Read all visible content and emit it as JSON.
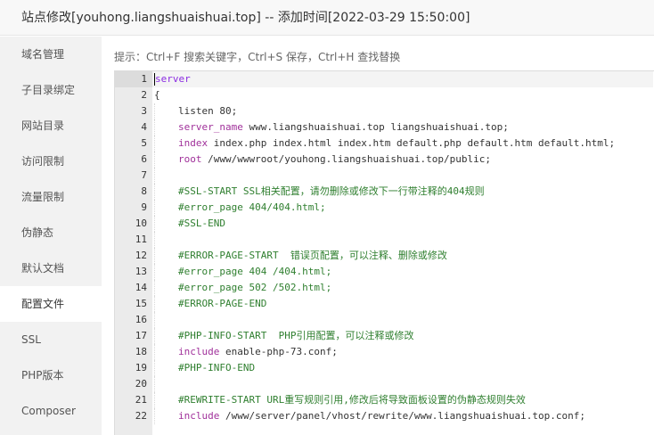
{
  "window": {
    "title": "站点修改[youhong.liangshuaishuai.top] -- 添加时间[2022-03-29 15:50:00]"
  },
  "sidebar": {
    "items": [
      {
        "label": "域名管理"
      },
      {
        "label": "子目录绑定"
      },
      {
        "label": "网站目录"
      },
      {
        "label": "访问限制"
      },
      {
        "label": "流量限制"
      },
      {
        "label": "伪静态"
      },
      {
        "label": "默认文档"
      },
      {
        "label": "配置文件",
        "active": true
      },
      {
        "label": "SSL"
      },
      {
        "label": "PHP版本"
      },
      {
        "label": "Composer"
      }
    ]
  },
  "editor": {
    "tip": "提示：Ctrl+F 搜索关键字，Ctrl+S 保存，Ctrl+H 查找替换",
    "active_line": 1,
    "lines": [
      {
        "n": "1",
        "text": "server"
      },
      {
        "n": "2",
        "text": "{"
      },
      {
        "n": "3",
        "text": "listen 80;"
      },
      {
        "n": "4",
        "kw": "server_name",
        "text": " www.liangshuaishuai.top liangshuaishuai.top;"
      },
      {
        "n": "5",
        "kw": "index",
        "text": " index.php index.html index.htm default.php default.htm default.html;"
      },
      {
        "n": "6",
        "kw": "root",
        "text": " /www/wwwroot/youhong.liangshuaishuai.top/public;"
      },
      {
        "n": "7",
        "text": ""
      },
      {
        "n": "8",
        "text": "#SSL-START SSL相关配置，请勿删除或修改下一行带注释的404规则"
      },
      {
        "n": "9",
        "text": "#error_page 404/404.html;"
      },
      {
        "n": "10",
        "text": "#SSL-END"
      },
      {
        "n": "11",
        "text": ""
      },
      {
        "n": "12",
        "text": "#ERROR-PAGE-START  错误页配置，可以注释、删除或修改"
      },
      {
        "n": "13",
        "text": "#error_page 404 /404.html;"
      },
      {
        "n": "14",
        "text": "#error_page 502 /502.html;"
      },
      {
        "n": "15",
        "text": "#ERROR-PAGE-END"
      },
      {
        "n": "16",
        "text": ""
      },
      {
        "n": "17",
        "text": "#PHP-INFO-START  PHP引用配置，可以注释或修改"
      },
      {
        "n": "18",
        "kw": "include",
        "text": " enable-php-73.conf;"
      },
      {
        "n": "19",
        "text": "#PHP-INFO-END"
      },
      {
        "n": "20",
        "text": ""
      },
      {
        "n": "21",
        "text": "#REWRITE-START URL重写规则引用,修改后将导致面板设置的伪静态规则失效"
      },
      {
        "n": "22",
        "kw": "include",
        "text": " /www/server/panel/vhost/rewrite/www.liangshuaishuai.top.conf;"
      }
    ]
  },
  "colors": {
    "keyword": "#8a2be2",
    "comment": "#2f7f2f",
    "gutter": "#ebebeb",
    "sidebar": "#f2f2f2"
  }
}
